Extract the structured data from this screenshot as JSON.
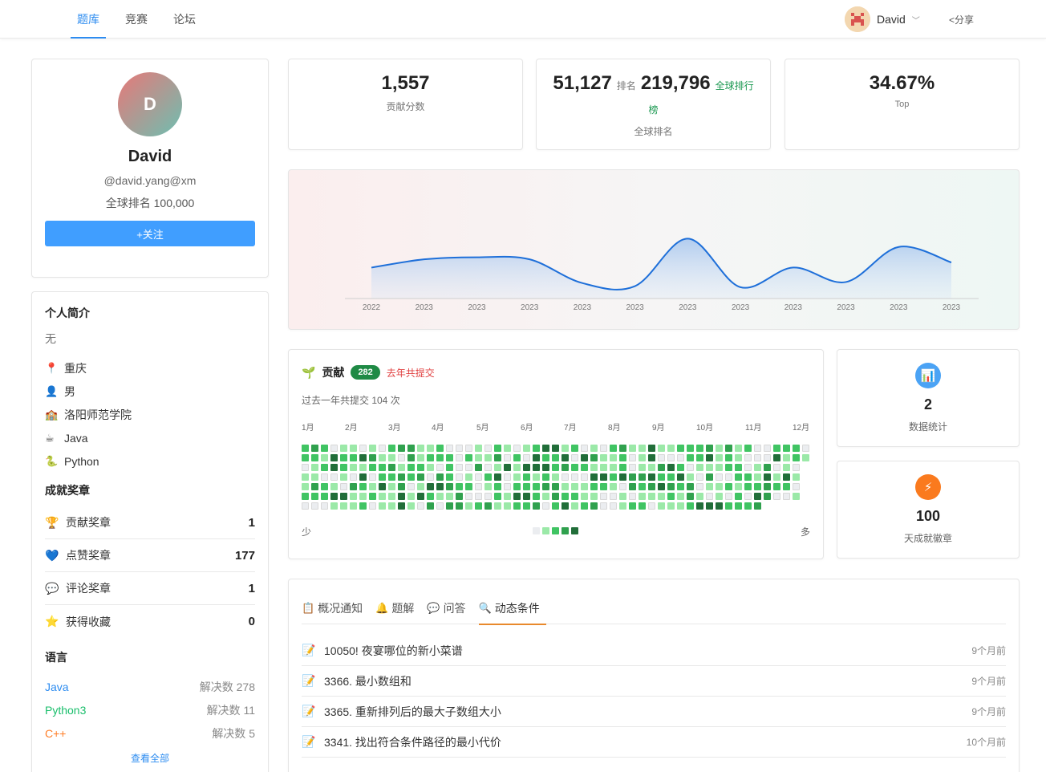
{
  "nav": {
    "items": [
      {
        "label": "题库",
        "active": true
      },
      {
        "label": "竞赛",
        "active": false
      },
      {
        "label": "论坛",
        "active": false
      }
    ],
    "user_name": "David",
    "share_label": "<分享"
  },
  "profile": {
    "avatar_letter": "D",
    "name": "David",
    "handle": "@david.yang@xm",
    "rank_text": "全球排名 100,000",
    "follow_label": "+关注"
  },
  "intro": {
    "title": "个人简介",
    "text": "无",
    "items": [
      {
        "icon": "pin-icon",
        "glyph": "📍",
        "text": "重庆"
      },
      {
        "icon": "person-icon",
        "glyph": "👤",
        "text": "男"
      },
      {
        "icon": "school-icon",
        "glyph": "🏫",
        "text": "洛阳师范学院"
      },
      {
        "icon": "coffee-icon",
        "glyph": "☕",
        "text": "Java"
      },
      {
        "icon": "snake-icon",
        "glyph": "🐍",
        "text": "Python"
      }
    ]
  },
  "awards": {
    "title": "成就奖章",
    "items": [
      {
        "icon": "trophy-icon",
        "glyph": "🏆",
        "label": "贡献奖章",
        "value": "1"
      },
      {
        "icon": "heart-icon",
        "glyph": "💙",
        "label": "点赞奖章",
        "value": "177"
      },
      {
        "icon": "comment-icon",
        "glyph": "💬",
        "label": "评论奖章",
        "value": "1"
      },
      {
        "icon": "star-icon",
        "glyph": "⭐",
        "label": "获得收藏",
        "value": "0"
      }
    ]
  },
  "languages": {
    "title": "语言",
    "items": [
      {
        "name": "Java",
        "solved": "解决数 278",
        "color": "#2d8cf0"
      },
      {
        "name": "Python3",
        "solved": "解决数 11",
        "color": "#19be6b"
      },
      {
        "name": "C++",
        "solved": "解决数 5",
        "color": "#ff7d26"
      }
    ],
    "view_all": "查看全部"
  },
  "stats": {
    "contribution": {
      "value": "1,557",
      "label": "贡献分数"
    },
    "global": {
      "value1": "51,127",
      "mid": "排名",
      "value2": "219,796",
      "link": "全球排行",
      "link2": "榜",
      "label": "全球排名"
    },
    "top": {
      "value": "34.67%",
      "label": "Top"
    }
  },
  "chart_data": {
    "type": "area",
    "x": [
      "2022",
      "2023",
      "2023",
      "2023",
      "2023",
      "2023",
      "2023",
      "2023",
      "2023",
      "2023",
      "2023",
      "2023"
    ],
    "values": [
      30,
      38,
      40,
      38,
      15,
      12,
      58,
      11,
      30,
      16,
      50,
      35
    ],
    "ylim": [
      0,
      70
    ],
    "line_color": "#1e6fd9",
    "grid": false
  },
  "contribution": {
    "title": "贡献",
    "count": "282",
    "count_note": "去年共提交",
    "subtitle": "过去一年共提交 104 次",
    "months": [
      "1月",
      "2月",
      "3月",
      "4月",
      "5月",
      "6月",
      "7月",
      "8月",
      "9月",
      "10月",
      "11月",
      "12月"
    ],
    "legend_less": "少",
    "legend_more": "多",
    "colors": [
      "#ebedf0",
      "#9be9a8",
      "#40c463",
      "#30a14e",
      "#216e39"
    ]
  },
  "side_stats": [
    {
      "icon": "chart-icon",
      "glyph": "📊",
      "color": "#4ba3f5",
      "value": "2",
      "label": "数据统计"
    },
    {
      "icon": "bolt-icon",
      "glyph": "⚡",
      "color": "#fa7a1e",
      "value": "100",
      "label": "天成就徽章"
    }
  ],
  "feed": {
    "tabs": [
      {
        "icon": "clipboard-icon",
        "glyph": "📋",
        "label": "概况通知",
        "active": false
      },
      {
        "icon": "bell-icon",
        "glyph": "🔔",
        "label": "题解",
        "active": false
      },
      {
        "icon": "chat-icon",
        "glyph": "💬",
        "label": "问答",
        "active": false
      },
      {
        "icon": "search-icon",
        "glyph": "🔍",
        "label": "动态条件",
        "active": true
      }
    ],
    "items": [
      {
        "title": "10050! 夜宴哪位的新小菜谱",
        "time": "9个月前"
      },
      {
        "title": "3366. 最小数组和",
        "time": "9个月前"
      },
      {
        "title": "3365. 重新排列后的最大子数组大小",
        "time": "9个月前"
      },
      {
        "title": "3341. 找出符合条件路径的最小代价",
        "time": "10个月前"
      }
    ]
  }
}
